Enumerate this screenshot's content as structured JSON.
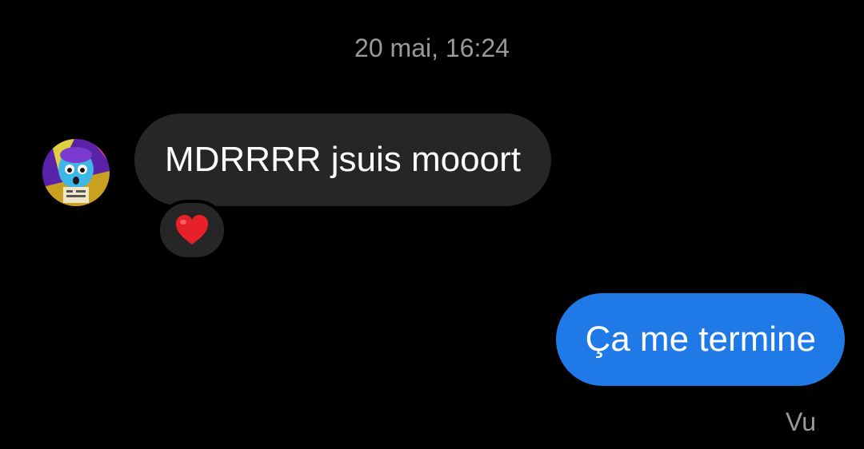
{
  "conversation": {
    "timestamp": "20 mai, 16:24",
    "messages": [
      {
        "direction": "incoming",
        "text": "MDRRRR jsuis mooort",
        "reaction": {
          "icon": "red-heart-icon",
          "color": "#e8202a"
        },
        "avatar": {
          "icon": "contact-avatar"
        }
      },
      {
        "direction": "outgoing",
        "text": "Ça me termine",
        "status": "Vu"
      }
    ]
  },
  "colors": {
    "background": "#000000",
    "incoming_bubble": "#262626",
    "outgoing_bubble": "#1f7ae8",
    "meta_text": "#9a9a9a",
    "message_text": "#ffffff"
  }
}
